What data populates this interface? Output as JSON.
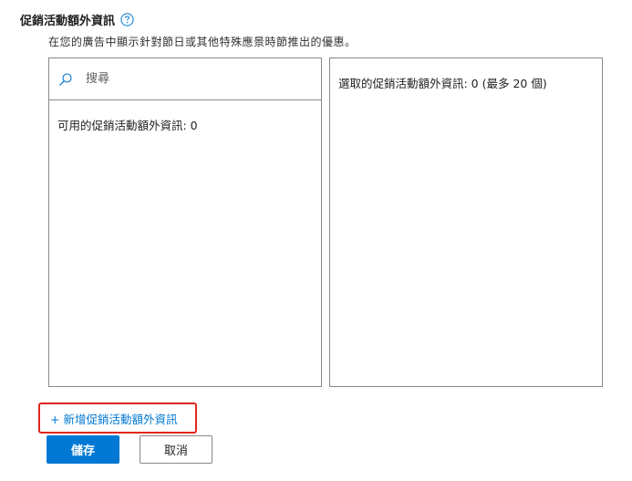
{
  "header": {
    "title": "促銷活動額外資訊",
    "help_icon": "question-circle-icon",
    "subtitle": "在您的廣告中顯示針對節日或其他特殊應景時節推出的優惠。"
  },
  "available_panel": {
    "search": {
      "icon": "search-icon",
      "placeholder": "搜尋",
      "value": ""
    },
    "label": "可用的促銷活動額外資訊: 0"
  },
  "selected_panel": {
    "label": "選取的促銷活動額外資訊: 0 (最多 20 個)"
  },
  "actions": {
    "add_link": "+ 新增促銷活動額外資訊",
    "save_label": "儲存",
    "cancel_label": "取消"
  },
  "colors": {
    "accent": "#0078d4",
    "highlight_border": "#e0261c",
    "panel_border": "#8a8886"
  }
}
